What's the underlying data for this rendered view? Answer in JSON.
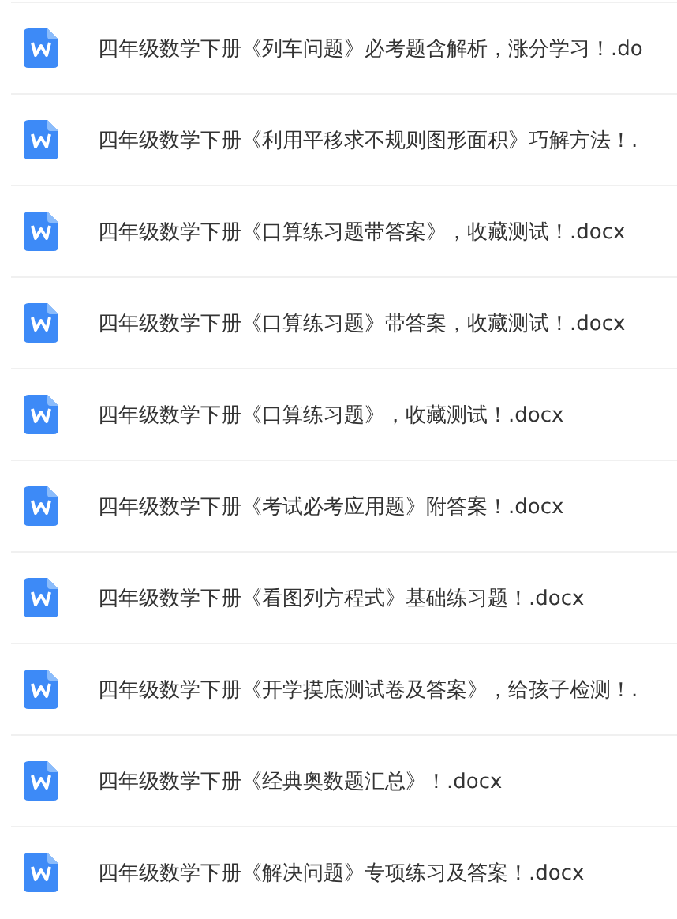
{
  "files": [
    {
      "name": "四年级数学下册《列车问题》必考题含解析，涨分学习！.do"
    },
    {
      "name": "四年级数学下册《利用平移求不规则图形面积》巧解方法！."
    },
    {
      "name": "四年级数学下册《口算练习题带答案》，收藏测试！.docx"
    },
    {
      "name": "四年级数学下册《口算练习题》带答案，收藏测试！.docx"
    },
    {
      "name": "四年级数学下册《口算练习题》，收藏测试！.docx"
    },
    {
      "name": "四年级数学下册《考试必考应用题》附答案！.docx"
    },
    {
      "name": "四年级数学下册《看图列方程式》基础练习题！.docx"
    },
    {
      "name": "四年级数学下册《开学摸底测试卷及答案》，给孩子检测！."
    },
    {
      "name": "四年级数学下册《经典奥数题汇总》！.docx"
    },
    {
      "name": "四年级数学下册《解决问题》专项练习及答案！.docx"
    }
  ]
}
